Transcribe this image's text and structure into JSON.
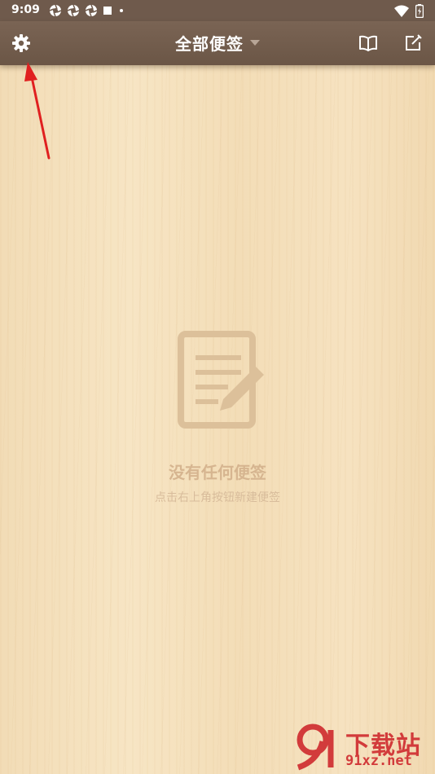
{
  "status_bar": {
    "time": "9:09",
    "left_icons": [
      "aperture-icon",
      "aperture-icon",
      "aperture-icon",
      "square-icon",
      "dot-icon"
    ],
    "right_icons": [
      "wifi-icon",
      "battery-icon"
    ]
  },
  "app_bar": {
    "title": "全部便签",
    "left_icon": "gear-icon",
    "right_icons": [
      "book-icon",
      "compose-icon"
    ],
    "background": "#6f5a4c"
  },
  "empty_state": {
    "icon": "note-edit-icon",
    "title": "没有任何便签",
    "subtitle": "点击右上角按钮新建便签"
  },
  "annotation": {
    "color": "#e02020"
  },
  "watermark": {
    "site": "下载站",
    "url": "91xz.net",
    "logo_text": "91"
  }
}
